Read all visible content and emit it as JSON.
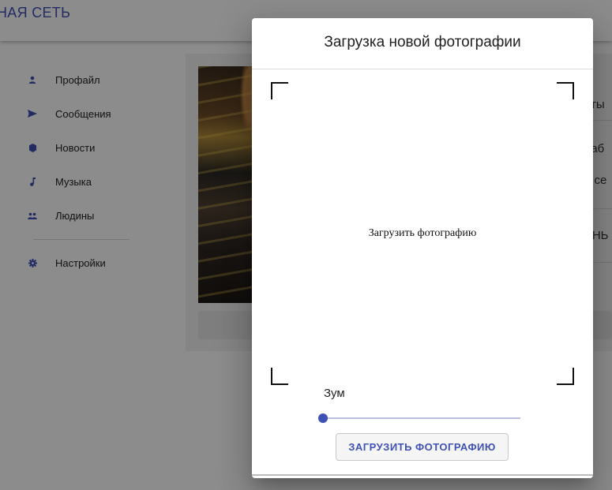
{
  "app": {
    "title": "НАЯ СЕТЬ",
    "accent_color": "#3f51b5"
  },
  "sidebar": {
    "items": [
      {
        "label": "Профайл",
        "icon": "person-icon"
      },
      {
        "label": "Сообщения",
        "icon": "send-icon"
      },
      {
        "label": "Новости",
        "icon": "news-icon"
      },
      {
        "label": "Музыка",
        "icon": "music-note-icon"
      },
      {
        "label": "Людины",
        "icon": "people-icon"
      }
    ],
    "settings": {
      "label": "Настройки",
      "icon": "gear-icon"
    }
  },
  "profile_partial": {
    "close_glyph": "‹",
    "line1": "оты",
    "line2": "раб",
    "line3": "о се",
    "line4": "ЬНЬ"
  },
  "dialog": {
    "title": "Загрузка новой фотографии",
    "crop_placeholder": "Загрузить фотографию",
    "zoom_label": "Зум",
    "zoom_value": 0,
    "upload_button": "ЗАГРУЗИТЬ ФОТОГРАФИЮ"
  }
}
